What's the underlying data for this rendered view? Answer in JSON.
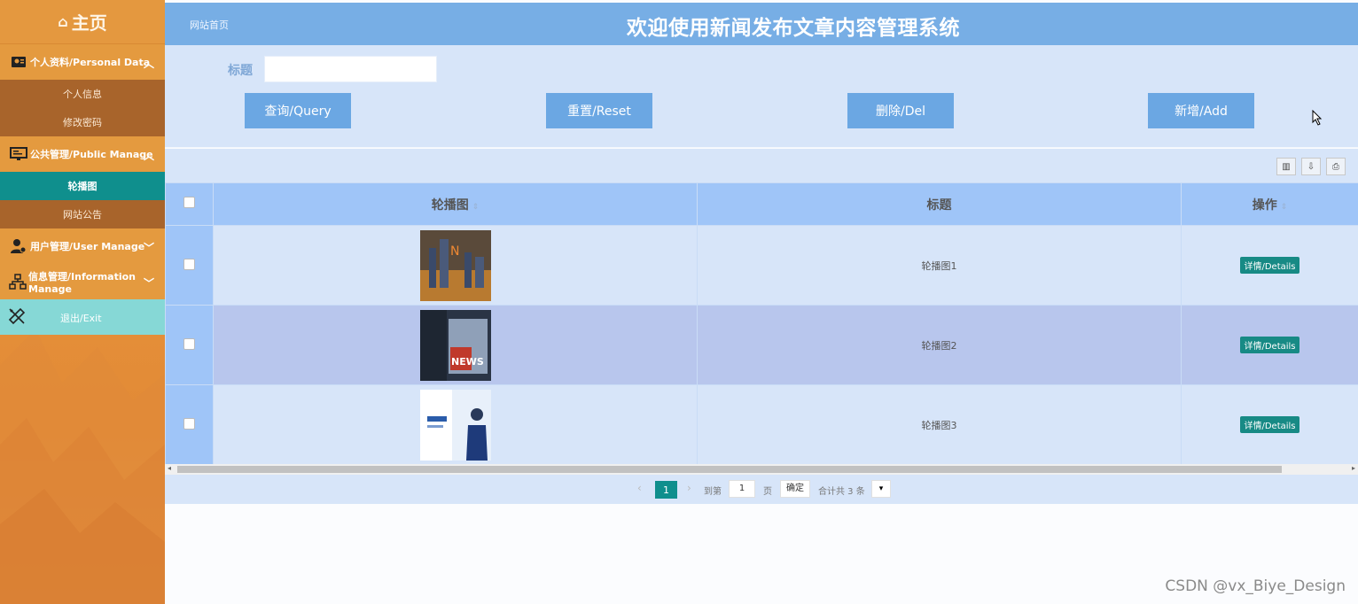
{
  "sidebar": {
    "home_label": "主页",
    "menus": [
      {
        "label": "个人资料/Personal Data",
        "icon": "person-card-icon",
        "items": [
          "个人信息",
          "修改密码"
        ]
      },
      {
        "label": "公共管理/Public Manage",
        "icon": "monitor-icon",
        "items": [
          "轮播图",
          "网站公告"
        ]
      },
      {
        "label": "用户管理/User Manage",
        "icon": "user-gear-icon"
      },
      {
        "label": "信息管理/Information Manage",
        "icon": "sitemap-icon"
      }
    ],
    "active_item": "轮播图",
    "exit_label": "退出/Exit"
  },
  "header": {
    "home_link": "网站首页",
    "title": "欢迎使用新闻发布文章内容管理系统"
  },
  "search": {
    "title_label": "标题",
    "title_value": "",
    "query_label": "查询/Query",
    "reset_label": "重置/Reset",
    "delete_label": "删除/Del",
    "add_label": "新增/Add"
  },
  "table": {
    "columns": [
      "轮播图",
      "标题",
      "操作"
    ],
    "rows": [
      {
        "title": "轮播图1",
        "action": "详情/Details"
      },
      {
        "title": "轮播图2",
        "action": "详情/Details"
      },
      {
        "title": "轮播图3",
        "action": "详情/Details"
      }
    ]
  },
  "pagination": {
    "current_page": "1",
    "goto_label": "到第",
    "goto_value": "1",
    "page_unit": "页",
    "confirm_label": "确定",
    "total_label": "合计共 3 条"
  },
  "watermark": "CSDN @vx_Biye_Design"
}
